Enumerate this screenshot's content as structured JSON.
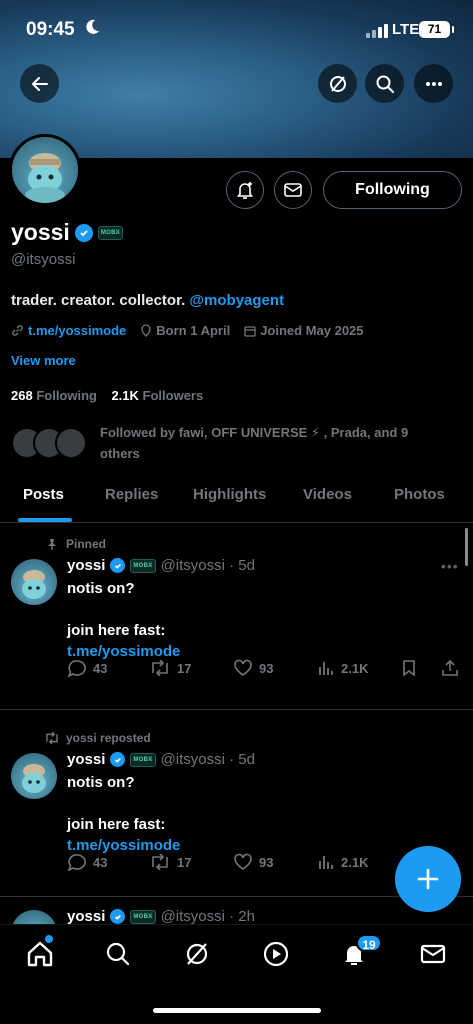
{
  "status_bar": {
    "time": "09:45",
    "network": "LTE",
    "battery": "71"
  },
  "profile": {
    "name": "yossi",
    "handle": "@itsyossi",
    "bio_text": "trader. creator. collector. ",
    "bio_mention": "@mobyagent",
    "link": "t.me/yossimode",
    "born": "Born 1 April",
    "joined": "Joined May 2025",
    "view_more": "View more",
    "following_count": "268",
    "following_label": "Following",
    "followers_count": "2.1K",
    "followers_label": "Followers",
    "followed_by": "Followed by fawi, OFF UNIVERSE ⚡ , Prada, and 9 others",
    "badge_text": "MOBX"
  },
  "buttons": {
    "following": "Following"
  },
  "tabs": [
    {
      "label": "Posts",
      "active": true
    },
    {
      "label": "Replies"
    },
    {
      "label": "Highlights"
    },
    {
      "label": "Videos"
    },
    {
      "label": "Photos"
    }
  ],
  "posts": [
    {
      "context": "Pinned",
      "name": "yossi",
      "meta": "@itsyossi · 5d",
      "line1": "notis on?",
      "line2": "join here fast:",
      "link": "t.me/yossimode",
      "replies": "43",
      "reposts": "17",
      "likes": "93",
      "views": "2.1K"
    },
    {
      "context": "yossi reposted",
      "name": "yossi",
      "meta": "@itsyossi · 5d",
      "line1": "notis on?",
      "line2": "join here fast:",
      "link": "t.me/yossimode",
      "replies": "43",
      "reposts": "17",
      "likes": "93",
      "views": "2.1K"
    },
    {
      "name": "yossi",
      "meta": "@itsyossi · 2h"
    }
  ],
  "nav": {
    "notifications_badge": "19"
  },
  "colors": {
    "accent": "#1d9bf0",
    "background": "#000000",
    "muted": "#71767b"
  }
}
